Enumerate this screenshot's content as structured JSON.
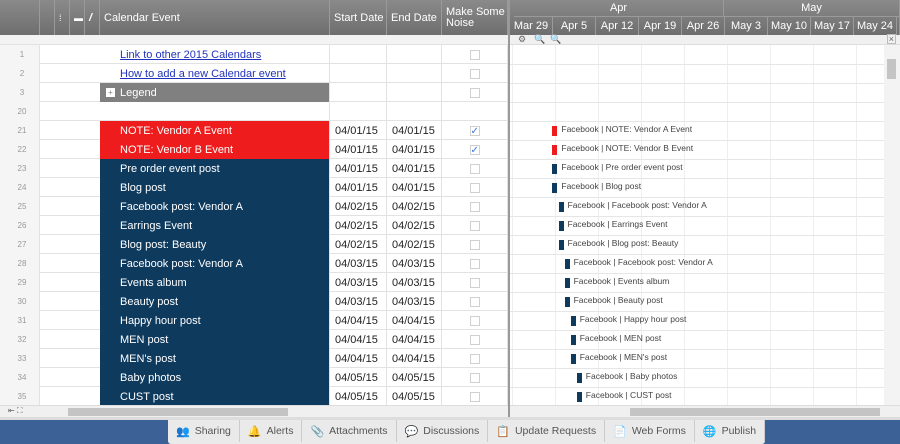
{
  "columns": {
    "event": "Calendar Event",
    "start": "Start Date",
    "end": "End Date",
    "noise": "Make Some Noise"
  },
  "timeline": {
    "months": [
      "Apr",
      "May"
    ],
    "weeks": [
      "Mar 29",
      "Apr 5",
      "Apr 12",
      "Apr 19",
      "Apr 26",
      "May 3",
      "May 10",
      "May 17",
      "May 24"
    ]
  },
  "colors": {
    "red": "#ee1c1c",
    "navy": "#0e3a5e",
    "legend": "#808080",
    "footer": "#3b6196"
  },
  "rows": [
    {
      "num": "1",
      "event": "Link to other 2015 Calendars",
      "type": "link",
      "start": "",
      "end": "",
      "noise": false
    },
    {
      "num": "2",
      "event": "How to add a new Calendar event",
      "type": "link",
      "start": "",
      "end": "",
      "noise": false
    },
    {
      "num": "3",
      "event": "Legend",
      "type": "legend",
      "start": "",
      "end": "",
      "noise": false
    },
    {
      "num": "20",
      "event": "",
      "type": "plain",
      "start": "",
      "end": "",
      "noise": null
    },
    {
      "num": "21",
      "event": "NOTE: Vendor A Event",
      "type": "red",
      "start": "04/01/15",
      "end": "04/01/15",
      "noise": true,
      "gantt": "Facebook | NOTE: Vendor A Event"
    },
    {
      "num": "22",
      "event": "NOTE: Vendor B Event",
      "type": "red",
      "start": "04/01/15",
      "end": "04/01/15",
      "noise": true,
      "gantt": "Facebook | NOTE: Vendor B Event"
    },
    {
      "num": "23",
      "event": "Pre order event post",
      "type": "navy",
      "start": "04/01/15",
      "end": "04/01/15",
      "noise": false,
      "gantt": "Facebook | Pre order event post"
    },
    {
      "num": "24",
      "event": "Blog post",
      "type": "navy",
      "start": "04/01/15",
      "end": "04/01/15",
      "noise": false,
      "gantt": "Facebook | Blog post"
    },
    {
      "num": "25",
      "event": "Facebook post: Vendor A",
      "type": "navy",
      "start": "04/02/15",
      "end": "04/02/15",
      "noise": false,
      "gantt": "Facebook | Facebook post: Vendor A"
    },
    {
      "num": "26",
      "event": "Earrings Event",
      "type": "navy",
      "start": "04/02/15",
      "end": "04/02/15",
      "noise": false,
      "gantt": "Facebook | Earrings Event"
    },
    {
      "num": "27",
      "event": "Blog post: Beauty",
      "type": "navy",
      "start": "04/02/15",
      "end": "04/02/15",
      "noise": false,
      "gantt": "Facebook | Blog post: Beauty"
    },
    {
      "num": "28",
      "event": "Facebook post: Vendor A",
      "type": "navy",
      "start": "04/03/15",
      "end": "04/03/15",
      "noise": false,
      "gantt": "Facebook | Facebook post: Vendor A"
    },
    {
      "num": "29",
      "event": "Events album",
      "type": "navy",
      "start": "04/03/15",
      "end": "04/03/15",
      "noise": false,
      "gantt": "Facebook | Events album"
    },
    {
      "num": "30",
      "event": "Beauty post",
      "type": "navy",
      "start": "04/03/15",
      "end": "04/03/15",
      "noise": false,
      "gantt": "Facebook | Beauty post"
    },
    {
      "num": "31",
      "event": "Happy hour post",
      "type": "navy",
      "start": "04/04/15",
      "end": "04/04/15",
      "noise": false,
      "gantt": "Facebook | Happy hour post"
    },
    {
      "num": "32",
      "event": "MEN post",
      "type": "navy",
      "start": "04/04/15",
      "end": "04/04/15",
      "noise": false,
      "gantt": "Facebook | MEN post"
    },
    {
      "num": "33",
      "event": "MEN's post",
      "type": "navy",
      "start": "04/04/15",
      "end": "04/04/15",
      "noise": false,
      "gantt": "Facebook | MEN's post"
    },
    {
      "num": "34",
      "event": "Baby photos",
      "type": "navy",
      "start": "04/05/15",
      "end": "04/05/15",
      "noise": false,
      "gantt": "Facebook | Baby photos"
    },
    {
      "num": "35",
      "event": "CUST post",
      "type": "navy",
      "start": "04/05/15",
      "end": "04/05/15",
      "noise": false,
      "gantt": "Facebook | CUST post"
    }
  ],
  "footer_tabs": [
    {
      "label": "Sharing",
      "icon": "users-icon",
      "glyph": "👥"
    },
    {
      "label": "Alerts",
      "icon": "bell-icon",
      "glyph": "🔔"
    },
    {
      "label": "Attachments",
      "icon": "paperclip-icon",
      "glyph": "📎"
    },
    {
      "label": "Discussions",
      "icon": "comment-icon",
      "glyph": "💬"
    },
    {
      "label": "Update Requests",
      "icon": "update-request-icon",
      "glyph": "📋"
    },
    {
      "label": "Web Forms",
      "icon": "form-icon",
      "glyph": "📄"
    },
    {
      "label": "Publish",
      "icon": "globe-icon",
      "glyph": "🌐"
    }
  ]
}
